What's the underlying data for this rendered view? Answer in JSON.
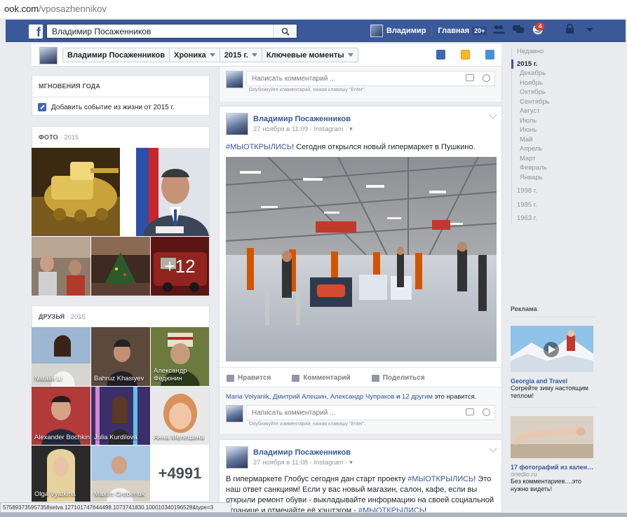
{
  "browser": {
    "url_domain": "ook.com",
    "url_path": "/vposazhennikov"
  },
  "topbar": {
    "search_value": "Владимир Посаженников",
    "user_name": "Владимир",
    "home_label": "Главная",
    "home_count": "20+",
    "notifications_count": "4"
  },
  "cover_nav": {
    "name": "Владимир Посаженников",
    "timeline": "Хроника",
    "year": "2015 г.",
    "highlights": "Ключевые моменты"
  },
  "moments": {
    "title": "Мгновения года",
    "add_label": "Добавить событие из жизни от 2015 г."
  },
  "photos": {
    "title": "Фото",
    "year": "· 2015",
    "more": "+12"
  },
  "friends": {
    "title": "Друзья",
    "year": "· 2015",
    "names": [
      "Natalia Li",
      "Bahruz Khasiyev",
      "Александр Федюнин",
      "Alexander Bochkin",
      "Julia Kurdilova",
      "Анна Мелешина",
      "Olga Vyatkina",
      "Maxim Grebenuk"
    ],
    "more": "+4991"
  },
  "top_comment": {
    "placeholder": "Написать комментарий ...",
    "hint": "Опубликуйте комментарий, нажав клавишу \"Enter\"."
  },
  "post1": {
    "author": "Владимир Посаженников",
    "meta": "27 ноября в 11:09 · Instagram · ",
    "hashtag": "#МЫОТКРЫЛИСЬ",
    "text": "! Сегодня открылся новый гипермаркет в Пушкино.",
    "like": "Нравится",
    "comment": "Комментарий",
    "share": "Поделиться",
    "likes_names": "Maria Volyanik, Дмитрий Алешин, Александр Чупраков",
    "likes_and": " и ",
    "likes_others": "12 другим",
    "likes_suffix": " это нравится.",
    "comment_placeholder": "Написать комментарий ...",
    "comment_hint": "Опубликуйте комментарий, нажав клавишу \"Enter\"."
  },
  "post2": {
    "author": "Владимир Посаженников",
    "meta": "27 ноября в 11:08 · Instagram · ",
    "t1": "В гипермаркете Глобус сегодня дан старт проекту ",
    "tag1": "#МЫОТКРЫЛИСЬ",
    "t2": "! Это наш ответ санкциям! Если у вас новый магазин, салон, кафе, если вы открыли ремонт обуви - выкладывайте информацию на своей социальной странице и отмечайте её хэштэгом - ",
    "tag2": "#МЫОТКРЫЛИСЬ",
    "t3": "!"
  },
  "timeline_nav": {
    "recent": "Недавно",
    "current_year": "2015 г.",
    "months": [
      "Декабрь",
      "Ноябрь",
      "Октябрь",
      "Сентябрь",
      "Август",
      "Июль",
      "Июнь",
      "Май",
      "Апрель",
      "Март",
      "Февраль",
      "Январь"
    ],
    "years": [
      "1998 г.",
      "1985 г.",
      "1963 г."
    ]
  },
  "ads": {
    "title": "Реклама",
    "items": [
      {
        "title": "Georgia and Travel",
        "domain": "",
        "text": "Согрейте зиму настоящим теплом!"
      },
      {
        "title": "17 фотографий из кален…",
        "domain": "onedio.ru",
        "text": "Без комментариев....это нужно видеть!"
      }
    ]
  },
  "statusbar": {
    "text": "575893735957358setva.127101747644498.1073741830.100010340196528&type=3"
  },
  "colors": {
    "brand": "#3b5998",
    "link": "#365899",
    "background": "#e9ebee"
  }
}
